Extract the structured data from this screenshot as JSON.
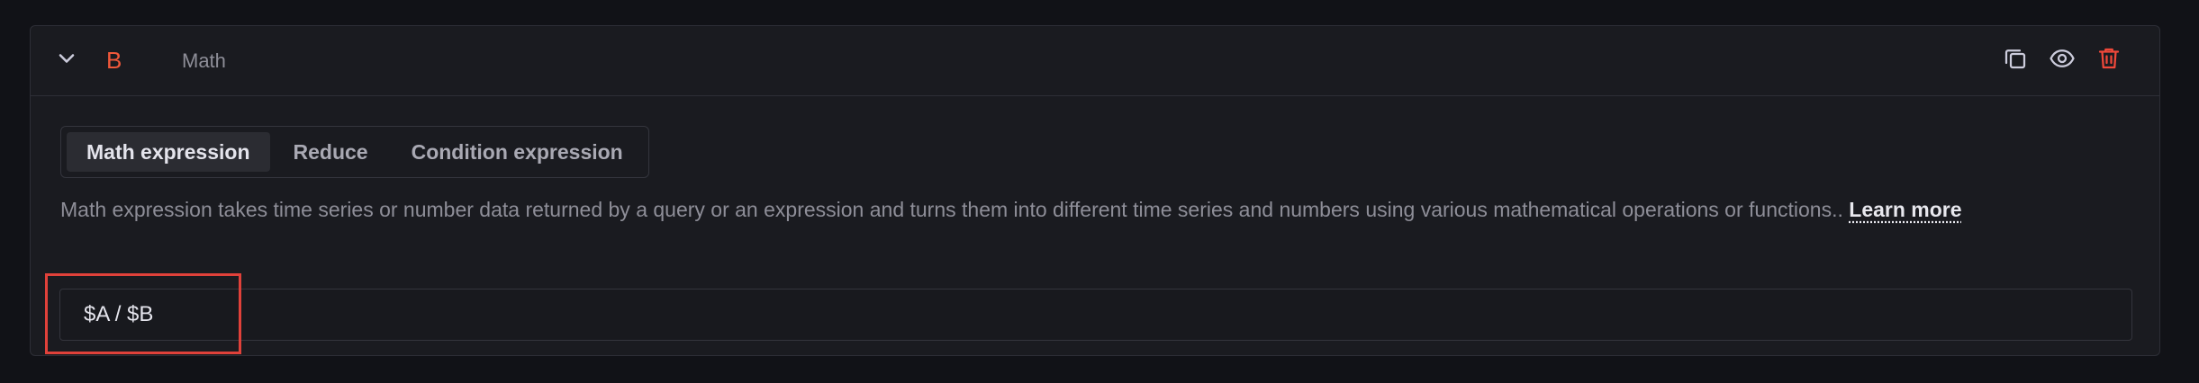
{
  "query": {
    "ref_id": "B",
    "expression_type": "Math",
    "collapse_icon": "chevron-down-icon",
    "actions": [
      {
        "name": "duplicate-query-button",
        "icon": "copy-icon"
      },
      {
        "name": "toggle-visibility-button",
        "icon": "eye-icon"
      },
      {
        "name": "delete-query-button",
        "icon": "trash-icon"
      }
    ]
  },
  "tabs": [
    {
      "label": "Math expression",
      "active": true
    },
    {
      "label": "Reduce",
      "active": false
    },
    {
      "label": "Condition expression",
      "active": false
    }
  ],
  "description": {
    "text": "Math expression takes time series or number data returned by a query or an expression and turns them into different time series and numbers using various mathematical operations or functions.. ",
    "link_label": "Learn more"
  },
  "expression_input": {
    "value": "$A / $B"
  },
  "colors": {
    "ref_id": "#f0583a",
    "delete_icon": "#f0483a",
    "highlight_box": "#e0413a",
    "panel_bg": "#1a1b20"
  }
}
